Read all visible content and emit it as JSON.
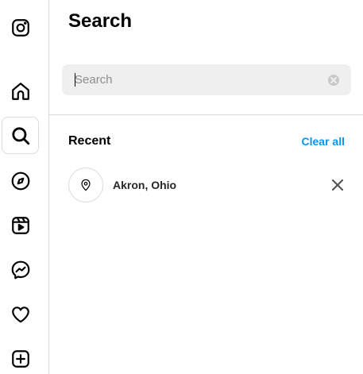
{
  "sidebar": {
    "items": [
      {
        "name": "instagram-logo-icon",
        "label": "Instagram"
      },
      {
        "name": "home-icon",
        "label": "Home"
      },
      {
        "name": "search-icon",
        "label": "Search",
        "active": true
      },
      {
        "name": "explore-icon",
        "label": "Explore"
      },
      {
        "name": "reels-icon",
        "label": "Reels"
      },
      {
        "name": "messenger-icon",
        "label": "Messages"
      },
      {
        "name": "heart-icon",
        "label": "Notifications"
      },
      {
        "name": "create-icon",
        "label": "Create"
      }
    ]
  },
  "panel": {
    "title": "Search",
    "search": {
      "placeholder": "Search",
      "value": ""
    },
    "recent": {
      "title": "Recent",
      "clear_label": "Clear all",
      "items": [
        {
          "type": "location",
          "icon": "location-pin-icon",
          "label": "Akron, Ohio"
        }
      ]
    }
  },
  "colors": {
    "accent": "#0095f6",
    "search_bg": "#efefef",
    "border": "#dbdbdb"
  }
}
